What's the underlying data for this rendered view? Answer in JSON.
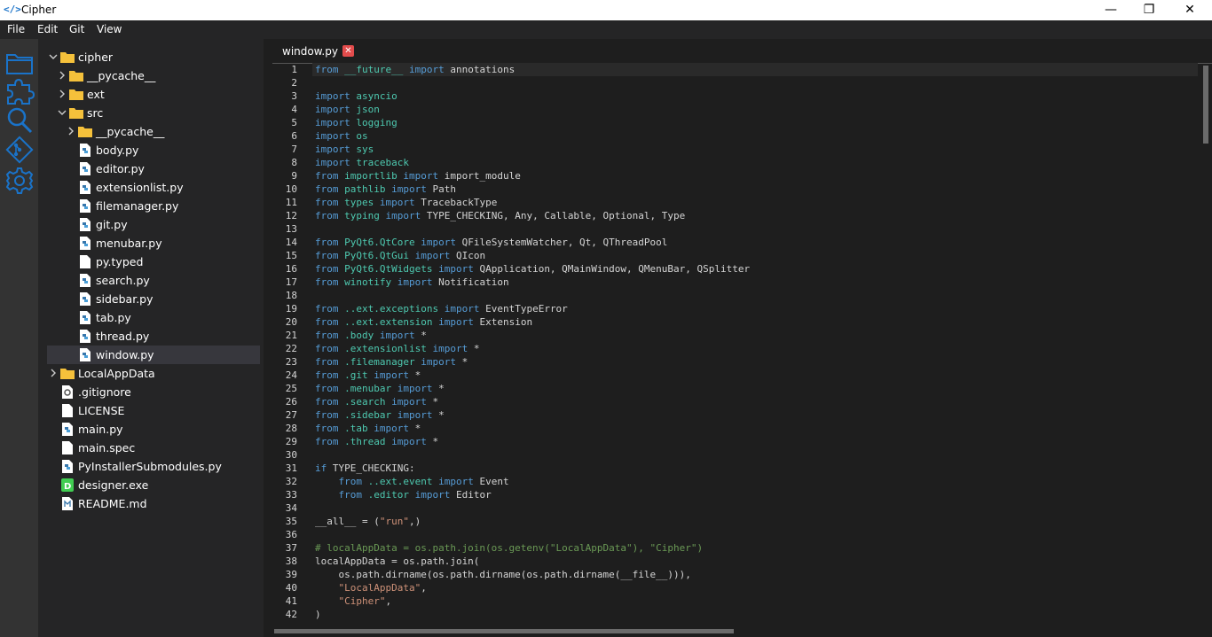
{
  "window": {
    "title": "Cipher",
    "icon_glyph": "</>",
    "minimize": "—",
    "maximize": "❐",
    "close": "✕"
  },
  "menu": [
    "File",
    "Edit",
    "Git",
    "View"
  ],
  "activity_icons": [
    "folder-icon",
    "puzzle-icon",
    "search-icon",
    "git-icon",
    "gear-icon"
  ],
  "explorer": [
    {
      "label": "cipher",
      "type": "folder",
      "depth": 0,
      "expanded": true
    },
    {
      "label": "__pycache__",
      "type": "folder",
      "depth": 1,
      "expanded": false
    },
    {
      "label": "ext",
      "type": "folder",
      "depth": 1,
      "expanded": false
    },
    {
      "label": "src",
      "type": "folder",
      "depth": 1,
      "expanded": true
    },
    {
      "label": "__pycache__",
      "type": "folder",
      "depth": 2,
      "expanded": false
    },
    {
      "label": "body.py",
      "type": "python",
      "depth": 2
    },
    {
      "label": "editor.py",
      "type": "python",
      "depth": 2
    },
    {
      "label": "extensionlist.py",
      "type": "python",
      "depth": 2
    },
    {
      "label": "filemanager.py",
      "type": "python",
      "depth": 2
    },
    {
      "label": "git.py",
      "type": "python",
      "depth": 2
    },
    {
      "label": "menubar.py",
      "type": "python",
      "depth": 2
    },
    {
      "label": "py.typed",
      "type": "file",
      "depth": 2
    },
    {
      "label": "search.py",
      "type": "python",
      "depth": 2
    },
    {
      "label": "sidebar.py",
      "type": "python",
      "depth": 2
    },
    {
      "label": "tab.py",
      "type": "python",
      "depth": 2
    },
    {
      "label": "thread.py",
      "type": "python",
      "depth": 2
    },
    {
      "label": "window.py",
      "type": "python",
      "depth": 2,
      "selected": true
    },
    {
      "label": "LocalAppData",
      "type": "folder",
      "depth": 0,
      "expanded": false
    },
    {
      "label": ".gitignore",
      "type": "config",
      "depth": 0
    },
    {
      "label": "LICENSE",
      "type": "file",
      "depth": 0
    },
    {
      "label": "main.py",
      "type": "python",
      "depth": 0
    },
    {
      "label": "main.spec",
      "type": "file",
      "depth": 0
    },
    {
      "label": "PyInstallerSubmodules.py",
      "type": "python",
      "depth": 0
    },
    {
      "label": "designer.exe",
      "type": "exe",
      "depth": 0
    },
    {
      "label": "README.md",
      "type": "markdown",
      "depth": 0
    }
  ],
  "tab": {
    "label": "window.py",
    "close_glyph": "✕"
  },
  "code_lines": [
    {
      "n": "1",
      "t": [
        [
          "kw",
          "from"
        ],
        [
          "p",
          " "
        ],
        [
          "mod",
          "__future__"
        ],
        [
          "p",
          " "
        ],
        [
          "kw",
          "import"
        ],
        [
          "p",
          " annotations"
        ]
      ]
    },
    {
      "n": "2",
      "t": []
    },
    {
      "n": "3",
      "t": [
        [
          "kw",
          "import"
        ],
        [
          "p",
          " "
        ],
        [
          "mod",
          "asyncio"
        ]
      ]
    },
    {
      "n": "4",
      "t": [
        [
          "kw",
          "import"
        ],
        [
          "p",
          " "
        ],
        [
          "mod",
          "json"
        ]
      ]
    },
    {
      "n": "5",
      "t": [
        [
          "kw",
          "import"
        ],
        [
          "p",
          " "
        ],
        [
          "mod",
          "logging"
        ]
      ]
    },
    {
      "n": "6",
      "t": [
        [
          "kw",
          "import"
        ],
        [
          "p",
          " "
        ],
        [
          "mod",
          "os"
        ]
      ]
    },
    {
      "n": "7",
      "t": [
        [
          "kw",
          "import"
        ],
        [
          "p",
          " "
        ],
        [
          "mod",
          "sys"
        ]
      ]
    },
    {
      "n": "8",
      "t": [
        [
          "kw",
          "import"
        ],
        [
          "p",
          " "
        ],
        [
          "mod",
          "traceback"
        ]
      ]
    },
    {
      "n": "9",
      "t": [
        [
          "kw",
          "from"
        ],
        [
          "p",
          " "
        ],
        [
          "mod",
          "importlib"
        ],
        [
          "p",
          " "
        ],
        [
          "kw",
          "import"
        ],
        [
          "p",
          " import_module"
        ]
      ]
    },
    {
      "n": "10",
      "t": [
        [
          "kw",
          "from"
        ],
        [
          "p",
          " "
        ],
        [
          "mod",
          "pathlib"
        ],
        [
          "p",
          " "
        ],
        [
          "kw",
          "import"
        ],
        [
          "p",
          " Path"
        ]
      ]
    },
    {
      "n": "11",
      "t": [
        [
          "kw",
          "from"
        ],
        [
          "p",
          " "
        ],
        [
          "mod",
          "types"
        ],
        [
          "p",
          " "
        ],
        [
          "kw",
          "import"
        ],
        [
          "p",
          " TracebackType"
        ]
      ]
    },
    {
      "n": "12",
      "t": [
        [
          "kw",
          "from"
        ],
        [
          "p",
          " "
        ],
        [
          "mod",
          "typing"
        ],
        [
          "p",
          " "
        ],
        [
          "kw",
          "import"
        ],
        [
          "p",
          " TYPE_CHECKING, Any, Callable, Optional, Type"
        ]
      ]
    },
    {
      "n": "13",
      "t": []
    },
    {
      "n": "14",
      "t": [
        [
          "kw",
          "from"
        ],
        [
          "p",
          " "
        ],
        [
          "mod",
          "PyQt6.QtCore"
        ],
        [
          "p",
          " "
        ],
        [
          "kw",
          "import"
        ],
        [
          "p",
          " QFileSystemWatcher, Qt, QThreadPool"
        ]
      ]
    },
    {
      "n": "15",
      "t": [
        [
          "kw",
          "from"
        ],
        [
          "p",
          " "
        ],
        [
          "mod",
          "PyQt6.QtGui"
        ],
        [
          "p",
          " "
        ],
        [
          "kw",
          "import"
        ],
        [
          "p",
          " QIcon"
        ]
      ]
    },
    {
      "n": "16",
      "t": [
        [
          "kw",
          "from"
        ],
        [
          "p",
          " "
        ],
        [
          "mod",
          "PyQt6.QtWidgets"
        ],
        [
          "p",
          " "
        ],
        [
          "kw",
          "import"
        ],
        [
          "p",
          " QApplication, QMainWindow, QMenuBar, QSplitter"
        ]
      ]
    },
    {
      "n": "17",
      "t": [
        [
          "kw",
          "from"
        ],
        [
          "p",
          " "
        ],
        [
          "mod",
          "winotify"
        ],
        [
          "p",
          " "
        ],
        [
          "kw",
          "import"
        ],
        [
          "p",
          " Notification"
        ]
      ]
    },
    {
      "n": "18",
      "t": []
    },
    {
      "n": "19",
      "t": [
        [
          "kw",
          "from"
        ],
        [
          "p",
          " "
        ],
        [
          "mod",
          "..ext.exceptions"
        ],
        [
          "p",
          " "
        ],
        [
          "kw",
          "import"
        ],
        [
          "p",
          " EventTypeError"
        ]
      ]
    },
    {
      "n": "20",
      "t": [
        [
          "kw",
          "from"
        ],
        [
          "p",
          " "
        ],
        [
          "mod",
          "..ext.extension"
        ],
        [
          "p",
          " "
        ],
        [
          "kw",
          "import"
        ],
        [
          "p",
          " Extension"
        ]
      ]
    },
    {
      "n": "21",
      "t": [
        [
          "kw",
          "from"
        ],
        [
          "p",
          " "
        ],
        [
          "mod",
          ".body"
        ],
        [
          "p",
          " "
        ],
        [
          "kw",
          "import"
        ],
        [
          "p",
          " *"
        ]
      ]
    },
    {
      "n": "22",
      "t": [
        [
          "kw",
          "from"
        ],
        [
          "p",
          " "
        ],
        [
          "mod",
          ".extensionlist"
        ],
        [
          "p",
          " "
        ],
        [
          "kw",
          "import"
        ],
        [
          "p",
          " *"
        ]
      ]
    },
    {
      "n": "23",
      "t": [
        [
          "kw",
          "from"
        ],
        [
          "p",
          " "
        ],
        [
          "mod",
          ".filemanager"
        ],
        [
          "p",
          " "
        ],
        [
          "kw",
          "import"
        ],
        [
          "p",
          " *"
        ]
      ]
    },
    {
      "n": "24",
      "t": [
        [
          "kw",
          "from"
        ],
        [
          "p",
          " "
        ],
        [
          "mod",
          ".git"
        ],
        [
          "p",
          " "
        ],
        [
          "kw",
          "import"
        ],
        [
          "p",
          " *"
        ]
      ]
    },
    {
      "n": "25",
      "t": [
        [
          "kw",
          "from"
        ],
        [
          "p",
          " "
        ],
        [
          "mod",
          ".menubar"
        ],
        [
          "p",
          " "
        ],
        [
          "kw",
          "import"
        ],
        [
          "p",
          " *"
        ]
      ]
    },
    {
      "n": "26",
      "t": [
        [
          "kw",
          "from"
        ],
        [
          "p",
          " "
        ],
        [
          "mod",
          ".search"
        ],
        [
          "p",
          " "
        ],
        [
          "kw",
          "import"
        ],
        [
          "p",
          " *"
        ]
      ]
    },
    {
      "n": "27",
      "t": [
        [
          "kw",
          "from"
        ],
        [
          "p",
          " "
        ],
        [
          "mod",
          ".sidebar"
        ],
        [
          "p",
          " "
        ],
        [
          "kw",
          "import"
        ],
        [
          "p",
          " *"
        ]
      ]
    },
    {
      "n": "28",
      "t": [
        [
          "kw",
          "from"
        ],
        [
          "p",
          " "
        ],
        [
          "mod",
          ".tab"
        ],
        [
          "p",
          " "
        ],
        [
          "kw",
          "import"
        ],
        [
          "p",
          " *"
        ]
      ]
    },
    {
      "n": "29",
      "t": [
        [
          "kw",
          "from"
        ],
        [
          "p",
          " "
        ],
        [
          "mod",
          ".thread"
        ],
        [
          "p",
          " "
        ],
        [
          "kw",
          "import"
        ],
        [
          "p",
          " *"
        ]
      ]
    },
    {
      "n": "30",
      "t": []
    },
    {
      "n": "31",
      "t": [
        [
          "kw",
          "if"
        ],
        [
          "p",
          " TYPE_CHECKING:"
        ]
      ]
    },
    {
      "n": "32",
      "t": [
        [
          "p",
          "    "
        ],
        [
          "kw",
          "from"
        ],
        [
          "p",
          " "
        ],
        [
          "mod",
          "..ext.event"
        ],
        [
          "p",
          " "
        ],
        [
          "kw",
          "import"
        ],
        [
          "p",
          " Event"
        ]
      ]
    },
    {
      "n": "33",
      "t": [
        [
          "p",
          "    "
        ],
        [
          "kw",
          "from"
        ],
        [
          "p",
          " "
        ],
        [
          "mod",
          ".editor"
        ],
        [
          "p",
          " "
        ],
        [
          "kw",
          "import"
        ],
        [
          "p",
          " Editor"
        ]
      ]
    },
    {
      "n": "34",
      "t": []
    },
    {
      "n": "35",
      "t": [
        [
          "p",
          "__all__ = ("
        ],
        [
          "str",
          "\"run\""
        ],
        [
          "p",
          ",)"
        ]
      ]
    },
    {
      "n": "36",
      "t": []
    },
    {
      "n": "37",
      "t": [
        [
          "cmt",
          "# localAppData = os.path.join(os.getenv(\"LocalAppData\"), \"Cipher\")"
        ]
      ]
    },
    {
      "n": "38",
      "t": [
        [
          "p",
          "localAppData = os.path.join("
        ]
      ]
    },
    {
      "n": "39",
      "t": [
        [
          "p",
          "    os.path.dirname(os.path.dirname(os.path.dirname(__file__))),"
        ]
      ]
    },
    {
      "n": "40",
      "t": [
        [
          "p",
          "    "
        ],
        [
          "str",
          "\"LocalAppData\""
        ],
        [
          "p",
          ","
        ]
      ]
    },
    {
      "n": "41",
      "t": [
        [
          "p",
          "    "
        ],
        [
          "str",
          "\"Cipher\""
        ],
        [
          "p",
          ","
        ]
      ]
    },
    {
      "n": "42",
      "t": [
        [
          "p",
          ")"
        ]
      ]
    }
  ],
  "current_line": "1",
  "colors": {
    "keyword": "#569cd6",
    "module": "#4ec9b0",
    "string": "#ce9178",
    "comment": "#6a9955",
    "accent": "#1a73c9"
  }
}
